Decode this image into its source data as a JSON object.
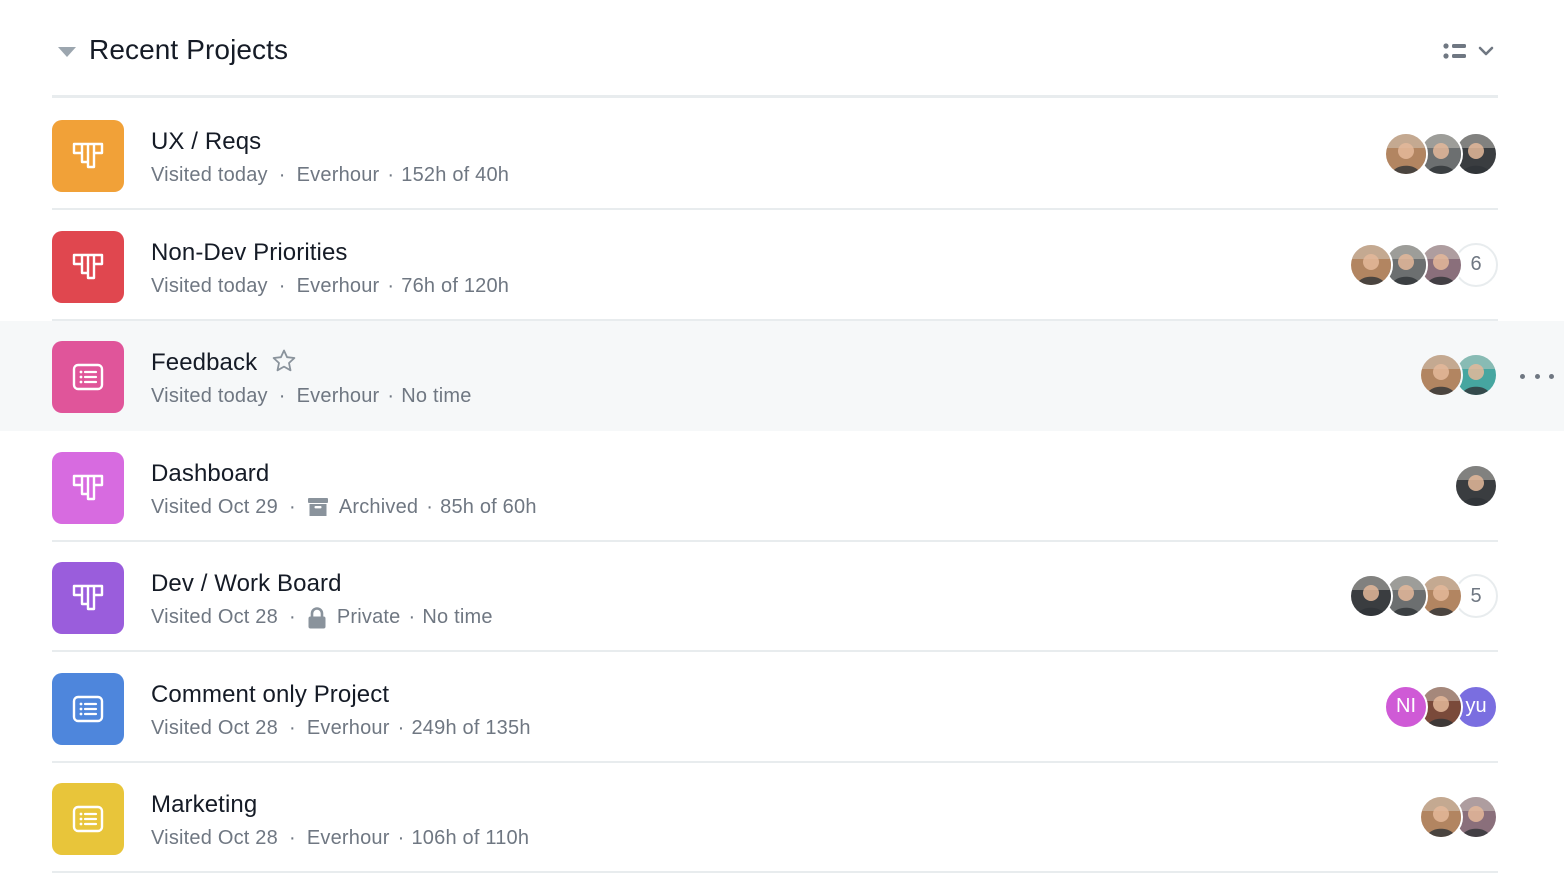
{
  "section": {
    "title": "Recent Projects",
    "collapse_icon": "triangle-down-icon",
    "view_menu_icons": [
      "list-view-icon",
      "chevron-down-icon"
    ]
  },
  "colors": {
    "orange": "#f1a138",
    "red": "#e0474f",
    "pink": "#e0559a",
    "magenta": "#d76be0",
    "purple": "#9a5ddc",
    "blue": "#4e86dc",
    "yellow": "#e8c53a",
    "hover_bg": "#f6f8f9",
    "meta_text": "#6f7782"
  },
  "projects": [
    {
      "name": "UX / Reqs",
      "icon": "board-icon",
      "color": "#f1a138",
      "visited": "Visited today",
      "team": "Everhour",
      "team_icon": "",
      "time": "152h of 40h",
      "avatars": [
        {
          "type": "photo",
          "tone": "#b28561"
        },
        {
          "type": "photo",
          "tone": "#6c6f70"
        },
        {
          "type": "photo",
          "tone": "#3a3d40"
        }
      ],
      "extra_count": ""
    },
    {
      "name": "Non-Dev Priorities",
      "icon": "board-icon",
      "color": "#e0474f",
      "visited": "Visited today",
      "team": "Everhour",
      "team_icon": "",
      "time": "76h of 120h",
      "avatars": [
        {
          "type": "photo",
          "tone": "#b28561"
        },
        {
          "type": "photo",
          "tone": "#6c6f70"
        },
        {
          "type": "photo",
          "tone": "#8a6f7b"
        }
      ],
      "extra_count": "6"
    },
    {
      "name": "Feedback",
      "icon": "list-icon",
      "color": "#e0559a",
      "visited": "Visited today",
      "team": "Everhour",
      "team_icon": "",
      "time": "No time",
      "starred": false,
      "hovered": true,
      "avatars": [
        {
          "type": "photo",
          "tone": "#b28561"
        },
        {
          "type": "photo",
          "tone": "#46a6a0"
        }
      ],
      "extra_count": ""
    },
    {
      "name": "Dashboard",
      "icon": "board-icon",
      "color": "#d76be0",
      "visited": "Visited Oct 29",
      "team": "Archived",
      "team_icon": "archive-box-icon",
      "time": "85h of 60h",
      "avatars": [
        {
          "type": "photo",
          "tone": "#3a3d40"
        }
      ],
      "extra_count": ""
    },
    {
      "name": "Dev / Work Board",
      "icon": "board-icon",
      "color": "#9a5ddc",
      "visited": "Visited Oct 28",
      "team": "Private",
      "team_icon": "lock-icon",
      "time": "No time",
      "avatars": [
        {
          "type": "photo",
          "tone": "#3a3d40"
        },
        {
          "type": "photo",
          "tone": "#6c6f70"
        },
        {
          "type": "photo",
          "tone": "#b28561"
        }
      ],
      "extra_count": "5"
    },
    {
      "name": "Comment only Project",
      "icon": "list-icon",
      "color": "#4e86dc",
      "visited": "Visited Oct 28",
      "team": "Everhour",
      "team_icon": "",
      "time": "249h of 135h",
      "avatars": [
        {
          "type": "initials",
          "text": "NI",
          "tone": "#cf5ad6"
        },
        {
          "type": "photo",
          "tone": "#7a4a3a"
        },
        {
          "type": "initials",
          "text": "yu",
          "tone": "#7a6ee0"
        }
      ],
      "extra_count": ""
    },
    {
      "name": "Marketing",
      "icon": "list-icon",
      "color": "#e8c53a",
      "visited": "Visited Oct 28",
      "team": "Everhour",
      "team_icon": "",
      "time": "106h of 110h",
      "avatars": [
        {
          "type": "photo",
          "tone": "#b28561"
        },
        {
          "type": "photo",
          "tone": "#8a6f7b"
        }
      ],
      "extra_count": ""
    }
  ]
}
